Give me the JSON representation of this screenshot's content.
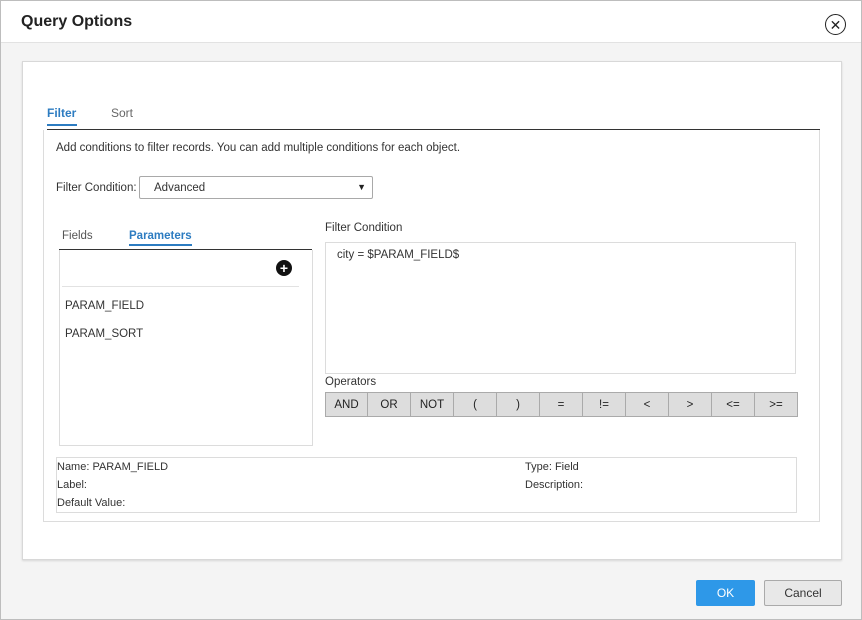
{
  "dialog": {
    "title": "Query Options",
    "close_icon": "close-icon"
  },
  "tabs": [
    {
      "label": "Filter",
      "active": true
    },
    {
      "label": "Sort",
      "active": false
    }
  ],
  "filter": {
    "description": "Add conditions to filter records. You can add multiple conditions for each object.",
    "condition_label": "Filter Condition:",
    "condition_value": "Advanced",
    "sub_tabs": [
      {
        "label": "Fields",
        "active": false
      },
      {
        "label": "Parameters",
        "active": true
      }
    ],
    "parameters": [
      "PARAM_FIELD",
      "PARAM_SORT"
    ],
    "condition_area_label": "Filter Condition",
    "condition_text": "city = $PARAM_FIELD$",
    "operators_label": "Operators",
    "operators": [
      "AND",
      "OR",
      "NOT",
      "(",
      ")",
      "=",
      "!=",
      "<",
      ">",
      "<=",
      ">="
    ]
  },
  "details": {
    "name": "Name:  PARAM_FIELD",
    "label": "Label:",
    "default_value": "Default Value:",
    "type": "Type:  Field",
    "description": "Description:"
  },
  "footer": {
    "ok_label": "OK",
    "cancel_label": "Cancel"
  },
  "colors": {
    "accent": "#2d7cc1",
    "ok_button": "#2e98e8"
  }
}
